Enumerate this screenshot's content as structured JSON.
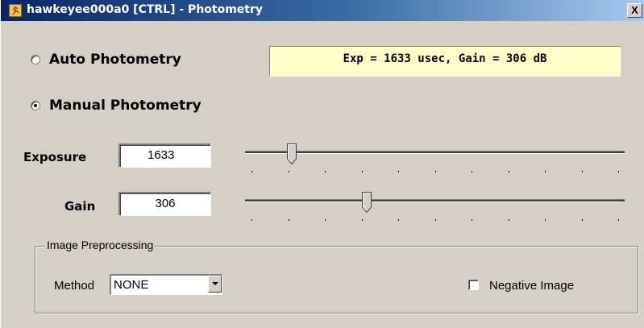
{
  "window": {
    "title": "hawkeyee000a0 [CTRL] - Photometry",
    "close_label": "X",
    "icon": "app-icon"
  },
  "photometry": {
    "auto_label": "Auto Photometry",
    "auto_checked": false,
    "manual_label": "Manual Photometry",
    "manual_checked": true,
    "status_text": "Exp = 1633 usec, Gain = 306 dB"
  },
  "exposure": {
    "label": "Exposure",
    "value": "1633",
    "slider_level": 0.1
  },
  "gain": {
    "label": "Gain",
    "value": "306",
    "slider_level": 0.31
  },
  "preprocessing": {
    "group_title": "Image Preprocessing",
    "method_label": "Method",
    "method_value": "NONE",
    "negative_label": "Negative Image",
    "negative_checked": false
  },
  "colors": {
    "dialog_bg": "#d4d0c8",
    "status_bg": "#ffffc8",
    "titlebar_start": "#0a246a",
    "titlebar_end": "#a6caf0"
  }
}
